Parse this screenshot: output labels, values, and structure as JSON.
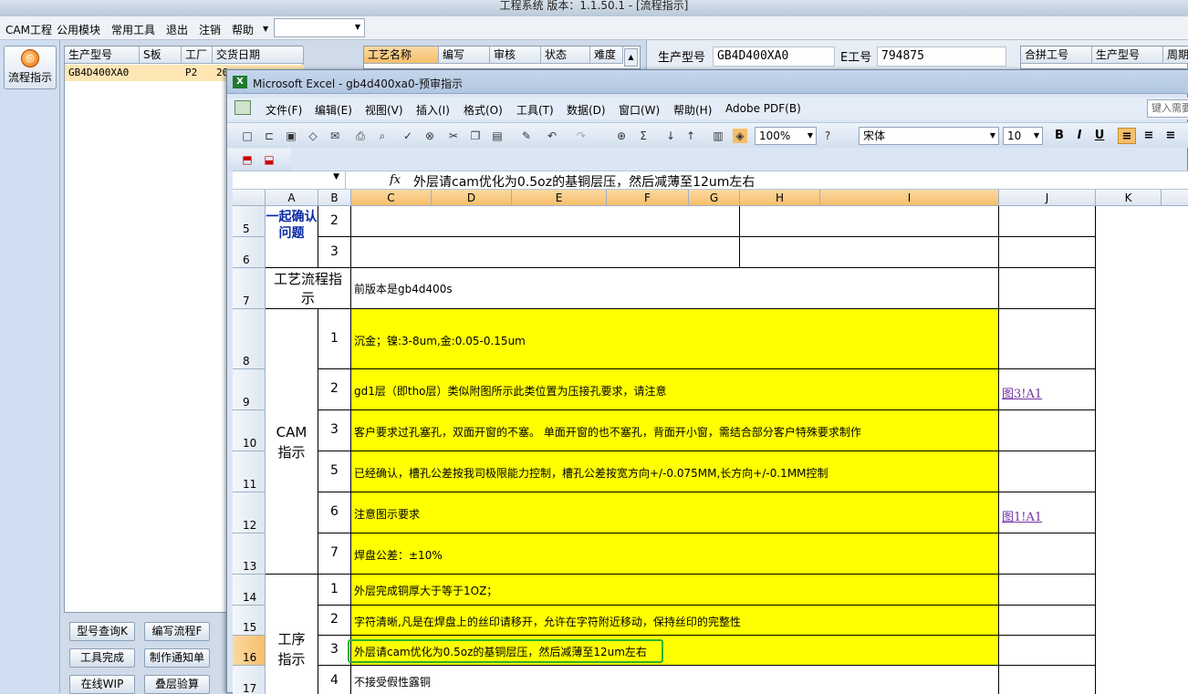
{
  "app": {
    "title": "工程系统   版本：1.1.50.1 - [流程指示]"
  },
  "menu": [
    "CAM工程",
    "公用模块",
    "常用工具",
    "退出",
    "注销",
    "帮助"
  ],
  "left_panel": {
    "flow_button": "流程指示"
  },
  "grid1": {
    "headers": [
      "生产型号",
      "S板",
      "工厂",
      "交货日期"
    ],
    "row": {
      "model": "GB4D400XA0",
      "plant": "P2",
      "date": "20"
    }
  },
  "grid2": {
    "headers": [
      "工艺名称",
      "编写",
      "审核",
      "状态",
      "难度"
    ]
  },
  "right_panel": {
    "model_label": "生产型号",
    "model_value": "GB4D400XA0",
    "eno_label": "E工号",
    "eno_value": "794875"
  },
  "grid3": {
    "headers": [
      "合拼工号",
      "生产型号",
      "周期"
    ]
  },
  "bottom_buttons": [
    "型号查询K",
    "编写流程F",
    "工具完成",
    "制作通知单",
    "在线WIP",
    "叠层验算"
  ],
  "excel": {
    "title": "Microsoft Excel - gb4d400xa0-预审指示",
    "menu": [
      "文件(F)",
      "编辑(E)",
      "视图(V)",
      "插入(I)",
      "格式(O)",
      "工具(T)",
      "数据(D)",
      "窗口(W)",
      "帮助(H)",
      "Adobe PDF(B)"
    ],
    "help_box": "键入需要",
    "zoom": "100%",
    "font": "宋体",
    "font_size": "10",
    "name_box": "",
    "fx": "fx",
    "formula": "外层请cam优化为0.5oz的基铜层压，然后减薄至12um左右",
    "columns": [
      "A",
      "B",
      "C",
      "D",
      "E",
      "F",
      "G",
      "H",
      "I",
      "J",
      "K"
    ],
    "rows": [
      "5",
      "6",
      "7",
      "8",
      "9",
      "10",
      "11",
      "12",
      "13",
      "14",
      "15",
      "16",
      "17"
    ],
    "sections": {
      "confirm": "一起确认问题",
      "flow": "工艺流程指示",
      "cam": "CAM指示",
      "process": "工序指示"
    },
    "cells": {
      "r5_b": "2",
      "r6_b": "3",
      "r7_c": "前版本是gb4d400s",
      "r8_b": "1",
      "r8_c": "沉金；镍:3-8um,金:0.05-0.15um",
      "r9_b": "2",
      "r9_c": "gd1层（即tho层）类似附图所示此类位置为压接孔要求，请注意",
      "r9_j": "图3!A1",
      "r10_b": "3",
      "r10_c": "客户要求过孔塞孔，双面开窗的不塞。 单面开窗的也不塞孔，背面开小窗，需结合部分客户特殊要求制作",
      "r11_b": "5",
      "r11_c": "已经确认，槽孔公差按我司极限能力控制，槽孔公差按宽方向+/-0.075MM,长方向+/-0.1MM控制",
      "r12_b": "6",
      "r12_c": "注意图示要求",
      "r12_j": "图1!A1",
      "r13_b": "7",
      "r13_c": "焊盘公差：±10%",
      "r14_b": "1",
      "r14_c": "外层完成铜厚大于等于1OZ；",
      "r15_b": "2",
      "r15_c": "字符清晰,凡是在焊盘上的丝印请移开，允许在字符附近移动，保持丝印的完整性",
      "r16_b": "3",
      "r16_c": "外层请cam优化为0.5oz的基铜层压，然后减薄至12um左右",
      "r17_b": "4",
      "r17_c": "不接受假性露铜"
    }
  }
}
